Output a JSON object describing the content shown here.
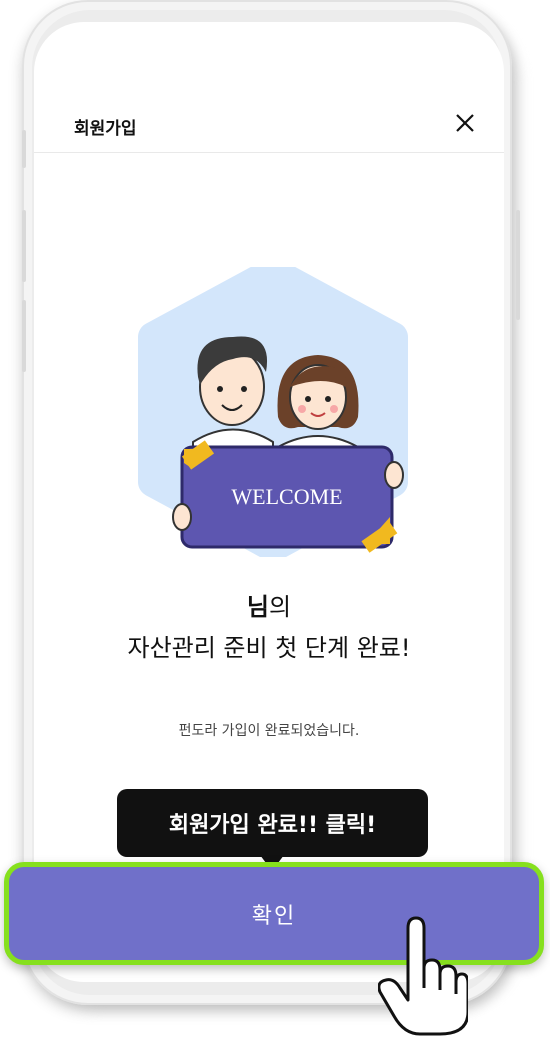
{
  "modal": {
    "title": "회원가입",
    "close_icon": "close-icon"
  },
  "illustration": {
    "sign_text": "WELCOME",
    "icon": "welcome-couple-illustration"
  },
  "completion": {
    "name_suffix_bold": "님",
    "name_suffix": "의",
    "headline": "자산관리 준비 첫 단계 완료!",
    "subtext": "펀도라 가입이 완료되었습니다."
  },
  "tooltip": {
    "text": "회원가입 완료!! 클릭!"
  },
  "confirm_button": {
    "label": "확인"
  },
  "colors": {
    "accent": "#7070c9",
    "highlight_border": "#86e01e",
    "hex_background": "#d3e6fb",
    "sign_purple": "#5d56b0",
    "sign_gold": "#f1b91f"
  }
}
